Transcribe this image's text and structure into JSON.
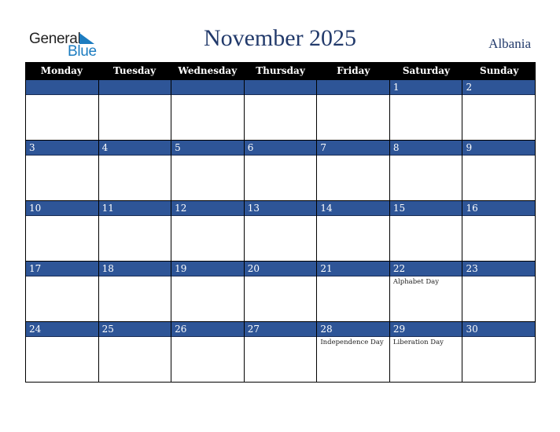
{
  "logo": {
    "general": "General",
    "blue": "Blue"
  },
  "title": "November 2025",
  "country": "Albania",
  "weekdays": [
    "Monday",
    "Tuesday",
    "Wednesday",
    "Thursday",
    "Friday",
    "Saturday",
    "Sunday"
  ],
  "weeks": [
    [
      {
        "day": ""
      },
      {
        "day": ""
      },
      {
        "day": ""
      },
      {
        "day": ""
      },
      {
        "day": ""
      },
      {
        "day": "1"
      },
      {
        "day": "2"
      }
    ],
    [
      {
        "day": "3"
      },
      {
        "day": "4"
      },
      {
        "day": "5"
      },
      {
        "day": "6"
      },
      {
        "day": "7"
      },
      {
        "day": "8"
      },
      {
        "day": "9"
      }
    ],
    [
      {
        "day": "10"
      },
      {
        "day": "11"
      },
      {
        "day": "12"
      },
      {
        "day": "13"
      },
      {
        "day": "14"
      },
      {
        "day": "15"
      },
      {
        "day": "16"
      }
    ],
    [
      {
        "day": "17"
      },
      {
        "day": "18"
      },
      {
        "day": "19"
      },
      {
        "day": "20"
      },
      {
        "day": "21"
      },
      {
        "day": "22",
        "event": "Alphabet Day"
      },
      {
        "day": "23"
      }
    ],
    [
      {
        "day": "24"
      },
      {
        "day": "25"
      },
      {
        "day": "26"
      },
      {
        "day": "27"
      },
      {
        "day": "28",
        "event": "Independence Day"
      },
      {
        "day": "29",
        "event": "Liberation Day"
      },
      {
        "day": "30"
      }
    ]
  ],
  "colors": {
    "header_bg": "#000000",
    "day_bar": "#2e5597",
    "title": "#223a6b",
    "brand_blue": "#1c7cc0"
  }
}
